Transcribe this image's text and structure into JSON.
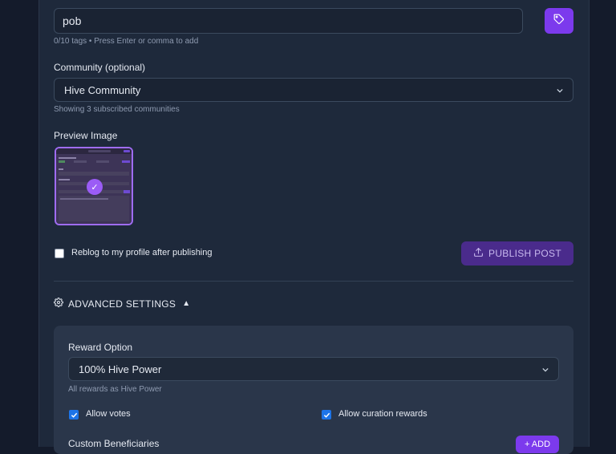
{
  "tags": {
    "input_value": "pob",
    "hint": "0/10 tags • Press Enter or comma to add",
    "button_icon": "tag-icon"
  },
  "community": {
    "label": "Community (optional)",
    "selected": "Hive Community",
    "hint": "Showing 3 subscribed communities"
  },
  "preview": {
    "label": "Preview Image",
    "check_glyph": "✓"
  },
  "reblog": {
    "label": "Reblog to my profile after publishing",
    "checked": false
  },
  "publish": {
    "label": "PUBLISH POST",
    "icon": "upload-icon"
  },
  "advanced": {
    "title": "ADVANCED SETTINGS",
    "toggle_glyph": "▲",
    "icon": "gear-icon",
    "reward_label": "Reward Option",
    "reward_selected": "100% Hive Power",
    "reward_hint": "All rewards as Hive Power",
    "allow_votes": "Allow votes",
    "allow_votes_checked": true,
    "allow_curation": "Allow curation rewards",
    "allow_curation_checked": true,
    "beneficiaries_label": "Custom Beneficiaries",
    "add_label": "+ ADD"
  },
  "colors": {
    "accent": "#7c3aed",
    "background": "#141b2b",
    "panel": "#1e293b",
    "checkbox_blue": "#1d74e8"
  }
}
